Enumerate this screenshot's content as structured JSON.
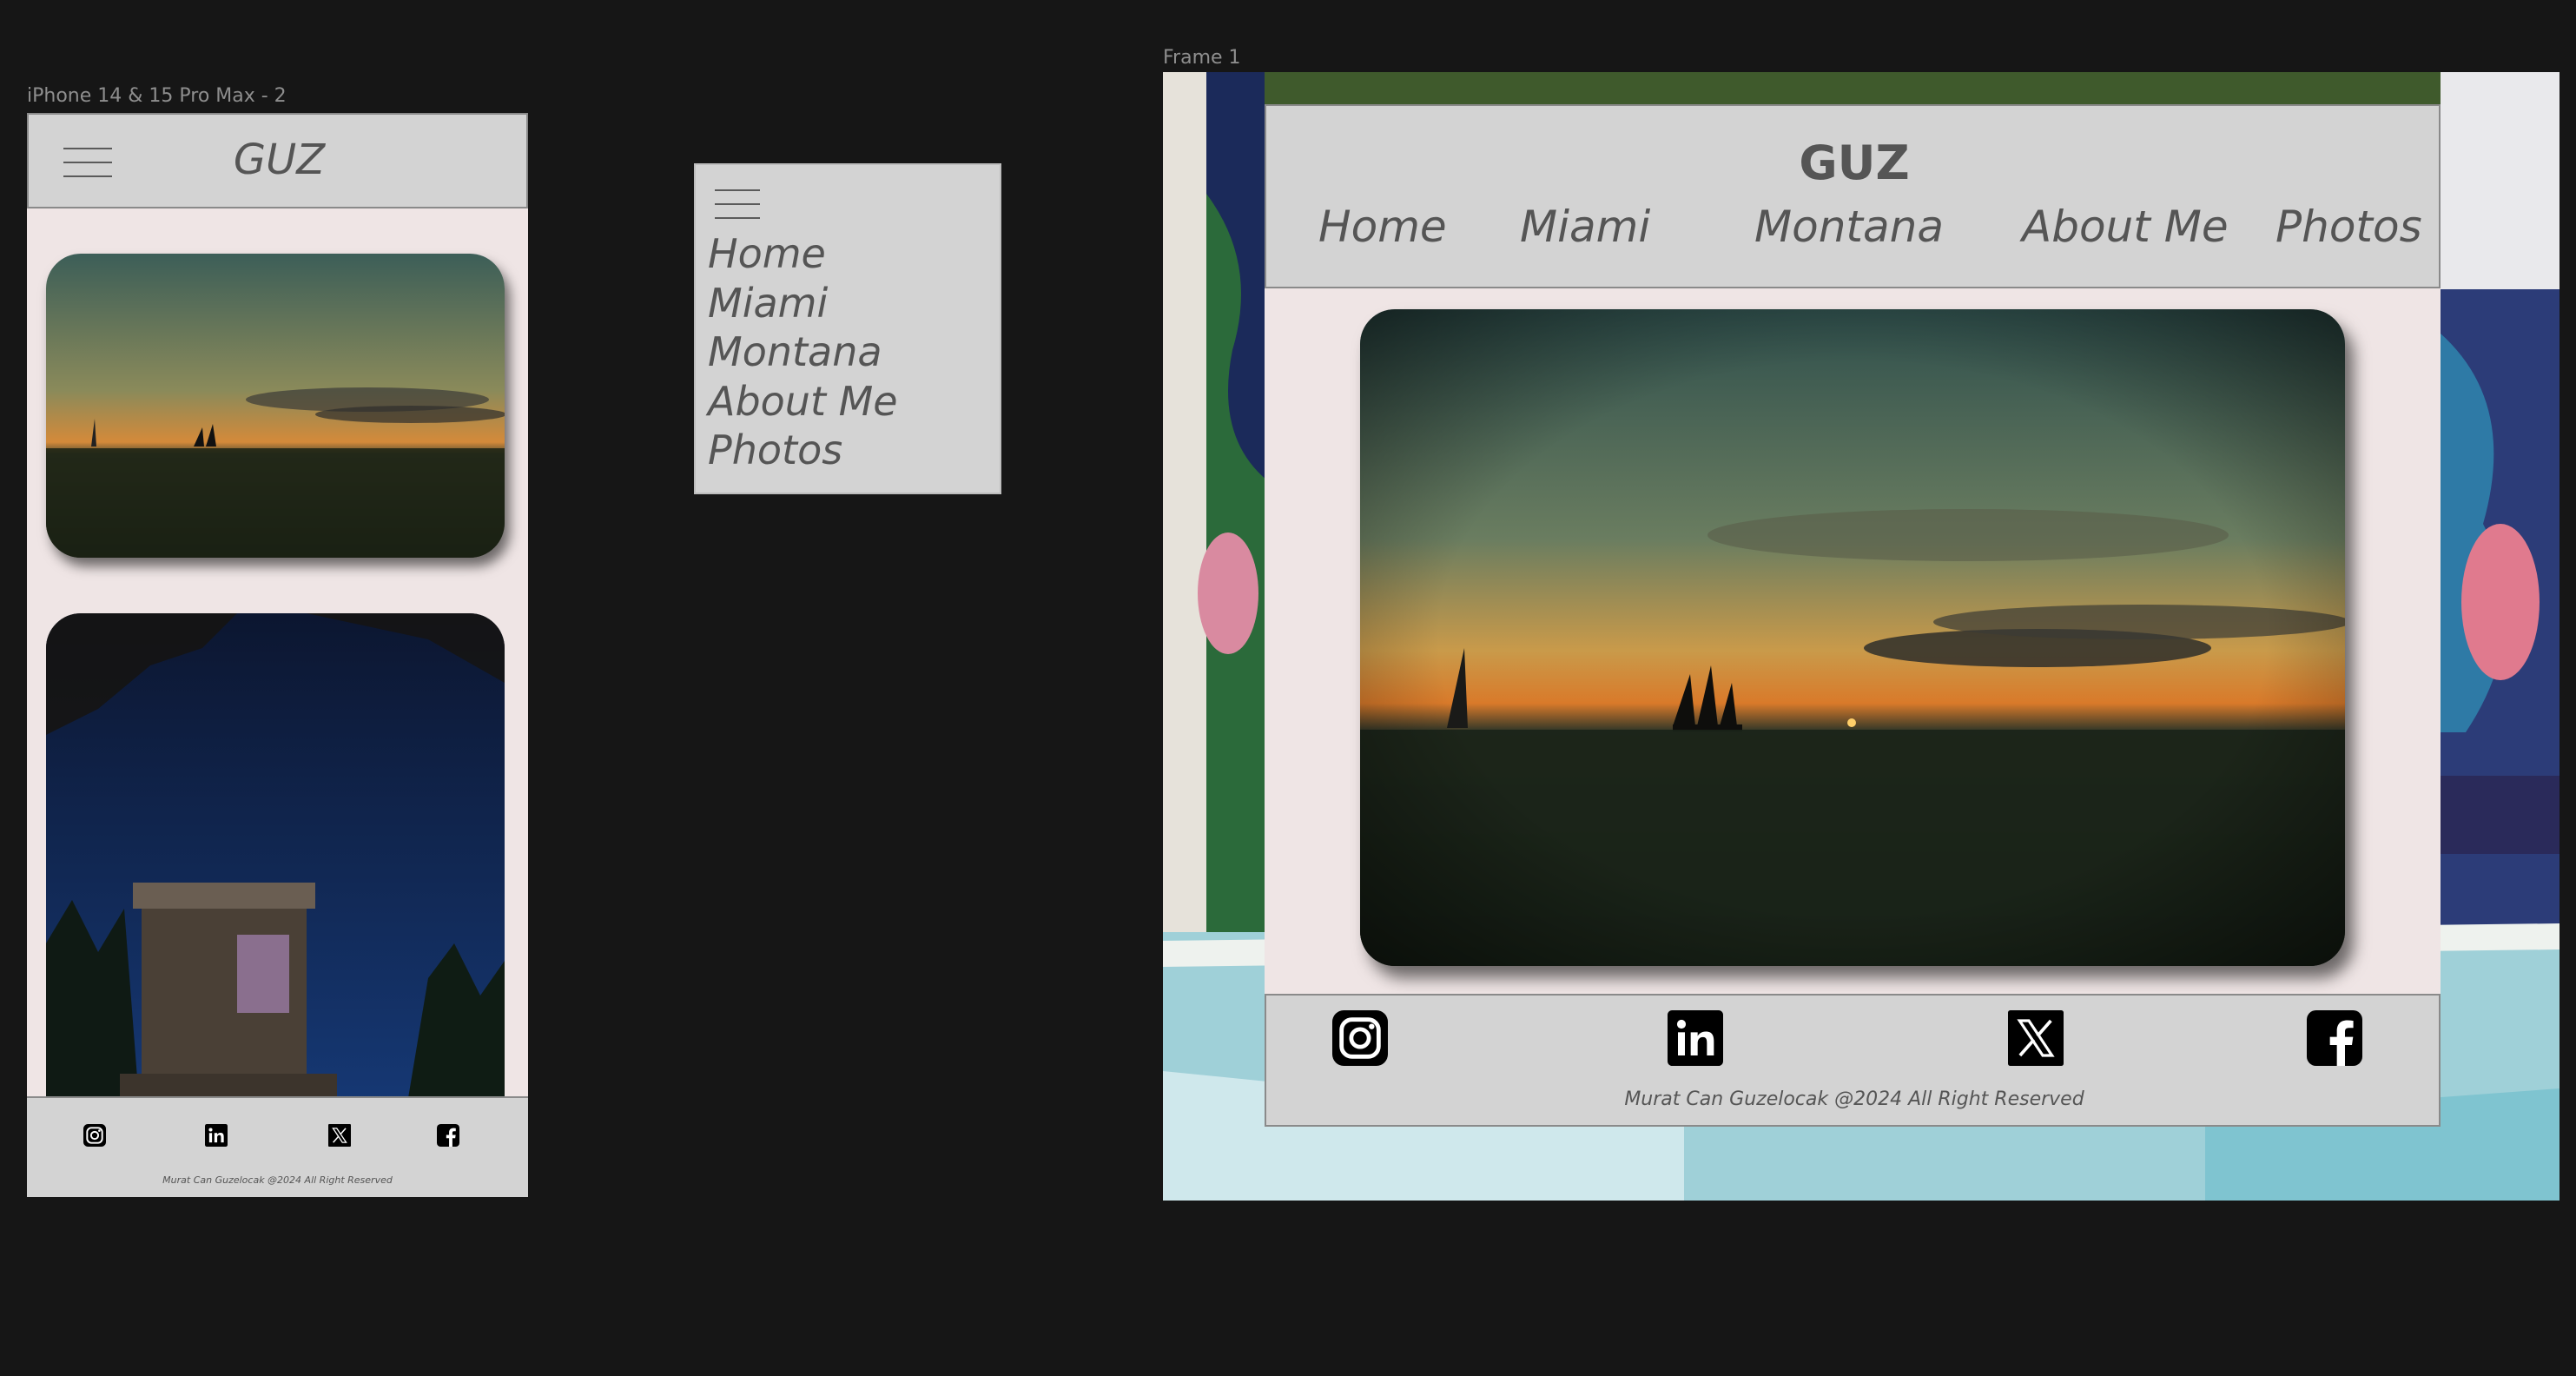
{
  "canvas": {
    "phone_frame_label": "iPhone 14 & 15 Pro Max - 2",
    "desktop_frame_label": "Frame 1"
  },
  "brand": "GUZ",
  "nav": {
    "items": [
      "Home",
      "Miami",
      "Montana",
      "About Me",
      "Photos"
    ]
  },
  "footer": {
    "copyright": "Murat Can Guzelocak @2024 All Right Reserved",
    "social_icons": [
      "instagram-icon",
      "linkedin-icon",
      "x-icon",
      "facebook-icon"
    ]
  },
  "colors": {
    "canvas_bg": "#161616",
    "bar_gray": "#d3d3d3",
    "content_pink": "#efe5e5",
    "text_gray": "#555555"
  }
}
